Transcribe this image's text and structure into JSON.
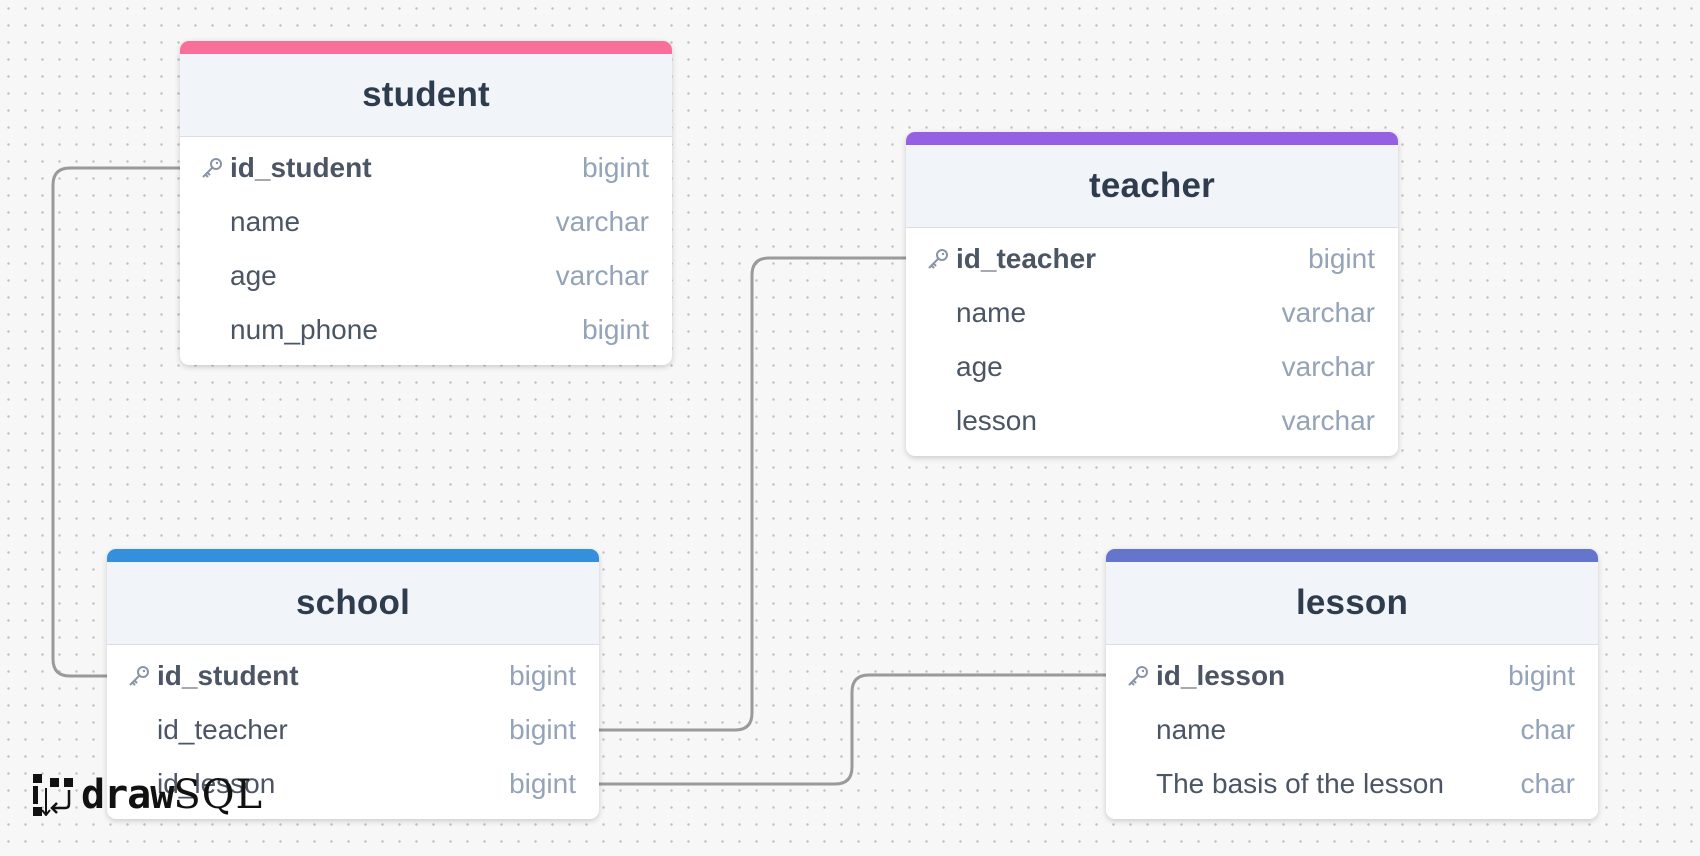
{
  "colors": {
    "student_accent": "#f87099",
    "teacher_accent": "#9561e2",
    "school_accent": "#3490dc",
    "lesson_accent": "#6574cd",
    "connector": "#9a9a9a"
  },
  "tables": {
    "student": {
      "title": "student",
      "columns": [
        {
          "name": "id_student",
          "type": "bigint",
          "primary_key": true
        },
        {
          "name": "name",
          "type": "varchar",
          "primary_key": false
        },
        {
          "name": "age",
          "type": "varchar",
          "primary_key": false
        },
        {
          "name": "num_phone",
          "type": "bigint",
          "primary_key": false
        }
      ]
    },
    "teacher": {
      "title": "teacher",
      "columns": [
        {
          "name": "id_teacher",
          "type": "bigint",
          "primary_key": true
        },
        {
          "name": "name",
          "type": "varchar",
          "primary_key": false
        },
        {
          "name": "age",
          "type": "varchar",
          "primary_key": false
        },
        {
          "name": "lesson",
          "type": "varchar",
          "primary_key": false
        }
      ]
    },
    "school": {
      "title": "school",
      "columns": [
        {
          "name": "id_student",
          "type": "bigint",
          "primary_key": true
        },
        {
          "name": "id_teacher",
          "type": "bigint",
          "primary_key": false
        },
        {
          "name": "id_lesson",
          "type": "bigint",
          "primary_key": false
        }
      ]
    },
    "lesson": {
      "title": "lesson",
      "columns": [
        {
          "name": "id_lesson",
          "type": "bigint",
          "primary_key": true
        },
        {
          "name": "name",
          "type": "char",
          "primary_key": false
        },
        {
          "name": "The basis of the lesson",
          "type": "char",
          "primary_key": false
        }
      ]
    }
  },
  "relations": [
    {
      "from": "school.id_student",
      "to": "student.id_student"
    },
    {
      "from": "school.id_teacher",
      "to": "teacher.id_teacher"
    },
    {
      "from": "school.id_lesson",
      "to": "lesson.id_lesson"
    }
  ],
  "logo": {
    "part1": "draw",
    "part2": "SQL",
    "icon": "drawsql-logo-icon"
  },
  "icons": {
    "primary_key": "key-icon"
  }
}
